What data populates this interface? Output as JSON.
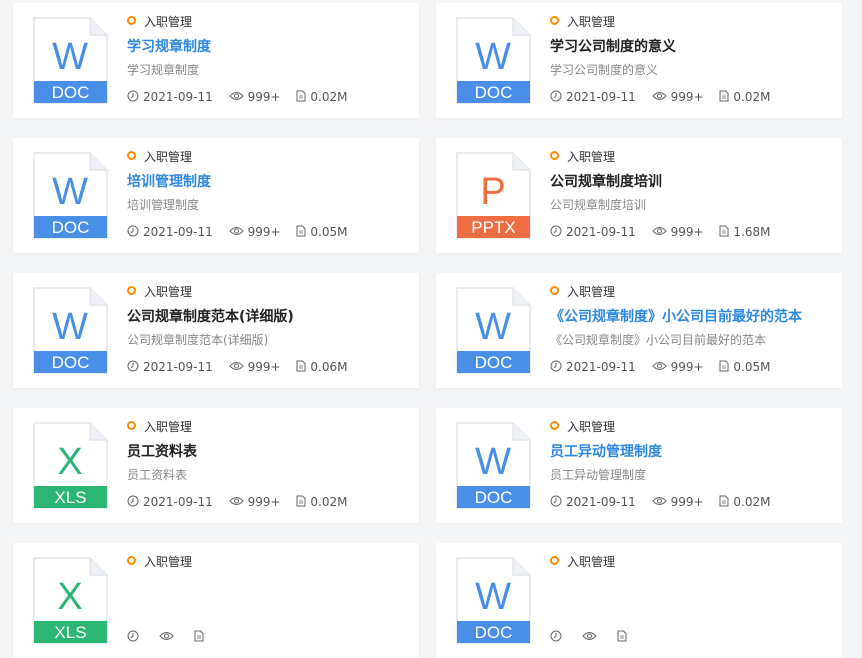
{
  "cards": [
    {
      "category": "入职管理",
      "title": "学习规章制度",
      "title_style": "link",
      "desc": "学习规章制度",
      "date": "2021-09-11",
      "views": "999+",
      "size": "0.02M",
      "file": {
        "type": "doc",
        "letter": "W",
        "label": "DOC",
        "color": "#4a8fe7"
      }
    },
    {
      "category": "入职管理",
      "title": "学习公司制度的意义",
      "title_style": "normal",
      "desc": "学习公司制度的意义",
      "date": "2021-09-11",
      "views": "999+",
      "size": "0.02M",
      "file": {
        "type": "doc",
        "letter": "W",
        "label": "DOC",
        "color": "#4a8fe7"
      }
    },
    {
      "category": "入职管理",
      "title": "培训管理制度",
      "title_style": "link",
      "desc": "培训管理制度",
      "date": "2021-09-11",
      "views": "999+",
      "size": "0.05M",
      "file": {
        "type": "doc",
        "letter": "W",
        "label": "DOC",
        "color": "#4a8fe7"
      }
    },
    {
      "category": "入职管理",
      "title": "公司规章制度培训",
      "title_style": "normal",
      "desc": "公司规章制度培训",
      "date": "2021-09-11",
      "views": "999+",
      "size": "1.68M",
      "file": {
        "type": "pptx",
        "letter": "P",
        "label": "PPTX",
        "color": "#ef6d43"
      }
    },
    {
      "category": "入职管理",
      "title": "公司规章制度范本(详细版)",
      "title_style": "normal",
      "desc": "公司规章制度范本(详细版)",
      "date": "2021-09-11",
      "views": "999+",
      "size": "0.06M",
      "file": {
        "type": "doc",
        "letter": "W",
        "label": "DOC",
        "color": "#4a8fe7"
      }
    },
    {
      "category": "入职管理",
      "title": "《公司规章制度》小公司目前最好的范本",
      "title_style": "link",
      "desc": "《公司规章制度》小公司目前最好的范本",
      "date": "2021-09-11",
      "views": "999+",
      "size": "0.05M",
      "file": {
        "type": "doc",
        "letter": "W",
        "label": "DOC",
        "color": "#4a8fe7"
      }
    },
    {
      "category": "入职管理",
      "title": "员工资料表",
      "title_style": "normal",
      "desc": "员工资料表",
      "date": "2021-09-11",
      "views": "999+",
      "size": "0.02M",
      "file": {
        "type": "xls",
        "letter": "X",
        "label": "XLS",
        "color": "#2bb673"
      }
    },
    {
      "category": "入职管理",
      "title": "员工异动管理制度",
      "title_style": "link",
      "desc": "员工异动管理制度",
      "date": "2021-09-11",
      "views": "999+",
      "size": "0.02M",
      "file": {
        "type": "doc",
        "letter": "W",
        "label": "DOC",
        "color": "#4a8fe7"
      }
    },
    {
      "category": "入职管理",
      "title": "",
      "title_style": "normal",
      "desc": "",
      "date": "",
      "views": "",
      "size": "",
      "file": {
        "type": "xls",
        "letter": "X",
        "label": "XLS",
        "color": "#2bb673"
      }
    },
    {
      "category": "入职管理",
      "title": "",
      "title_style": "normal",
      "desc": "",
      "date": "",
      "views": "",
      "size": "",
      "file": {
        "type": "doc",
        "letter": "W",
        "label": "DOC",
        "color": "#4a8fe7"
      }
    }
  ]
}
